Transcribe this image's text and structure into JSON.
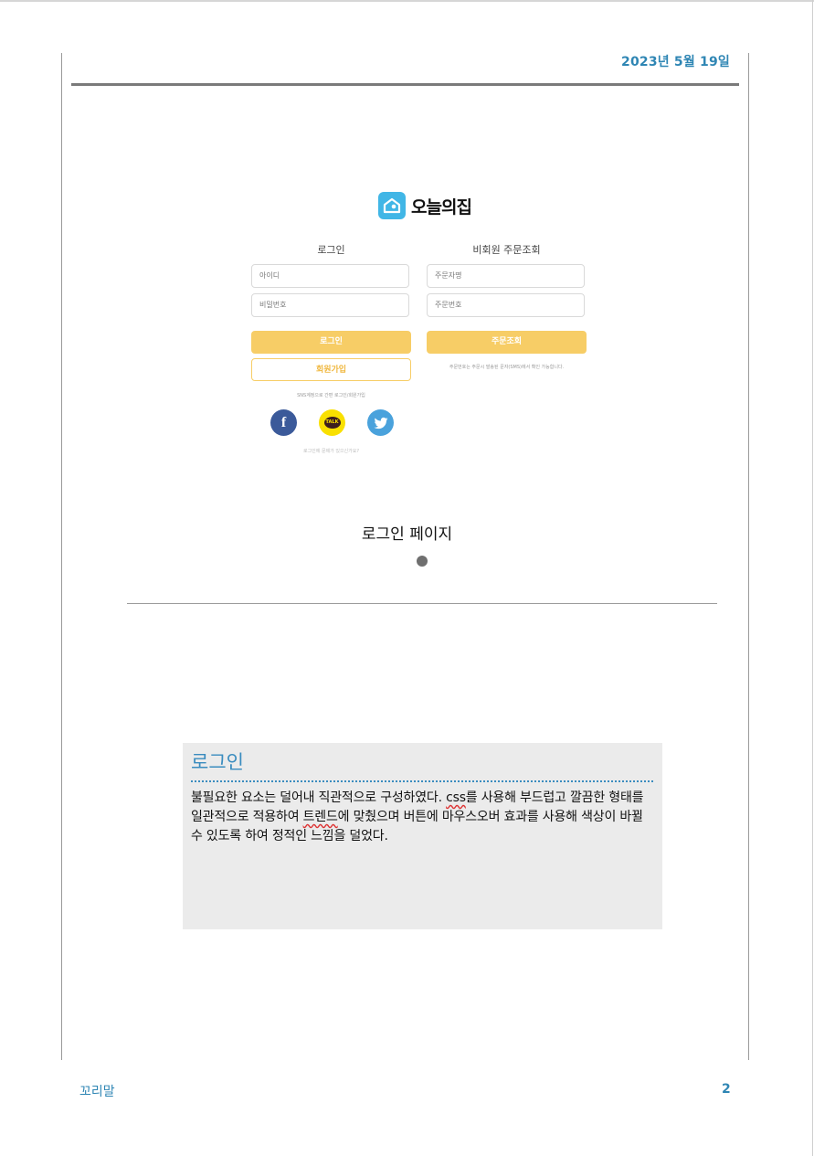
{
  "header": {
    "date": "2023년 5월 19일"
  },
  "screenshot": {
    "logo_text": "오늘의집",
    "login": {
      "title": "로그인",
      "id_placeholder": "아이디",
      "password_placeholder": "비밀번호",
      "login_button": "로그인",
      "signup_button": "회원가입",
      "sns_hint": "SNS계정으로 간편 로그인/회원가입",
      "sns": [
        {
          "name": "facebook",
          "glyph": "f",
          "color": "#3b5a9a"
        },
        {
          "name": "kakaotalk",
          "glyph": "TALK",
          "color": "#f9e000"
        },
        {
          "name": "twitter",
          "color": "#4aa2dc"
        }
      ],
      "help_link": "로그인에 문제가 있으신가요?"
    },
    "guest": {
      "title": "비회원 주문조회",
      "orderer_placeholder": "주문자명",
      "order_no_placeholder": "주문번호",
      "lookup_button": "주문조회",
      "hint": "주문번호는 주문시 발송된 문자(SMS)에서 확인 가능합니다."
    }
  },
  "caption": "로그인 페이지",
  "note": {
    "title": "로그인",
    "body_parts": [
      "불필요한 요소는 덜어내 직관적으로 구성하였다. ",
      "css",
      "를 사용해 부드럽고 깔끔한 형태를 일관적으로 적용하여 ",
      "트렌드",
      "에 맞췄으며 버튼에 마우스오버 효과를 사용해 색상이 바뀔 수 있도록 하여 정적인 느낌을 덜었다."
    ]
  },
  "footer": {
    "label": "꼬리말",
    "page_number": "2"
  },
  "colors": {
    "accent": "#2f86b4",
    "button": "#f7cd66",
    "note_bg": "#ebebeb"
  }
}
